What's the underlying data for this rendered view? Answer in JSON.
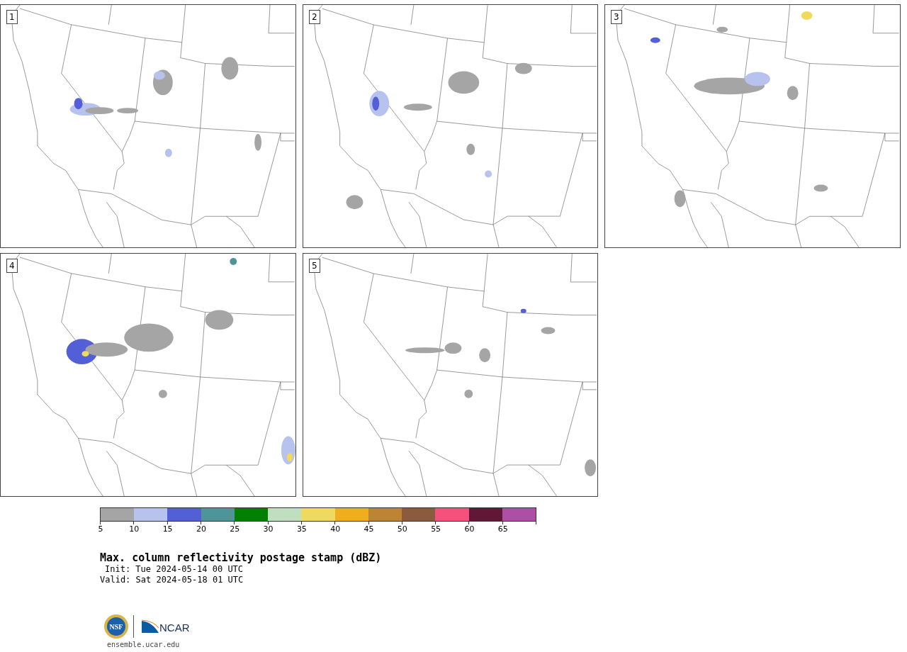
{
  "panels": [
    {
      "label": "1"
    },
    {
      "label": "2"
    },
    {
      "label": "3"
    },
    {
      "label": "4"
    },
    {
      "label": "5"
    }
  ],
  "colorbar": {
    "segments": [
      {
        "color": "#a5a5a5"
      },
      {
        "color": "#b8c2ef"
      },
      {
        "color": "#525fd6"
      },
      {
        "color": "#4f9499"
      },
      {
        "color": "#008200"
      },
      {
        "color": "#c0dfc0"
      },
      {
        "color": "#f0da5e"
      },
      {
        "color": "#f0ae1e"
      },
      {
        "color": "#bc8533"
      },
      {
        "color": "#8a5b3d"
      },
      {
        "color": "#f4517d"
      },
      {
        "color": "#611736"
      },
      {
        "color": "#ae4ea5"
      }
    ],
    "ticks": [
      "5",
      "10",
      "15",
      "20",
      "25",
      "30",
      "35",
      "40",
      "45",
      "50",
      "55",
      "60",
      "65"
    ]
  },
  "title": "Max. column reflectivity postage stamp (dBZ)",
  "init": "Init: Tue 2024-05-14 00 UTC",
  "valid": "Valid: Sat 2024-05-18 01 UTC",
  "logos": {
    "nsf": "NSF",
    "ncar": "NCAR"
  },
  "url": "ensemble.ucar.edu"
}
